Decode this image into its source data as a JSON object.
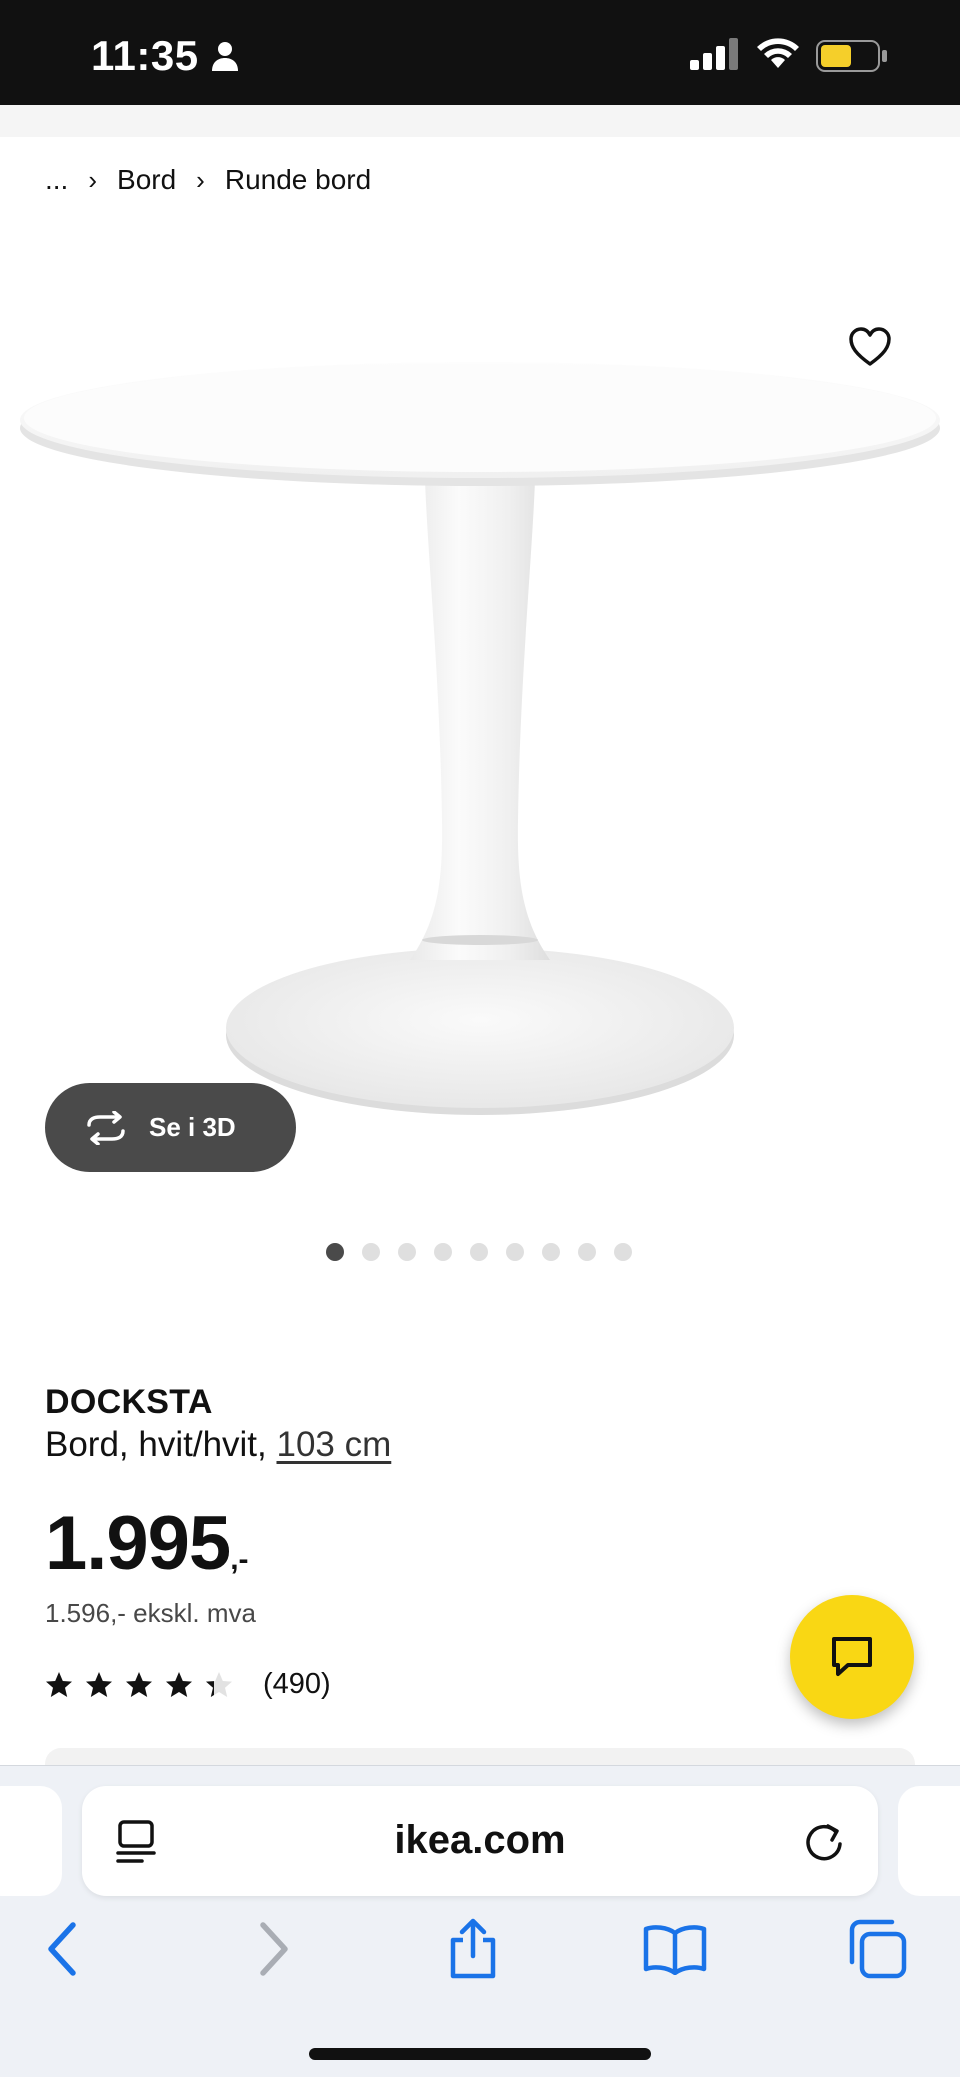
{
  "status_bar": {
    "time": "11:35",
    "icons": [
      "person-icon",
      "signal-icon",
      "wifi-icon",
      "battery-icon"
    ],
    "battery_color": "#f5cf2a"
  },
  "breadcrumb": {
    "items": [
      "...",
      "Bord",
      "Runde bord"
    ]
  },
  "gallery": {
    "see_3d_label": "Se i 3D",
    "favorite_icon": "heart-icon",
    "image_count": 9,
    "active_index": 0
  },
  "product": {
    "name": "DOCKSTA",
    "description": "Bord, hvit/hvit, ",
    "size_link": "103 cm",
    "price": "1.995",
    "price_suffix": ",-",
    "price_excl_vat": "1.596,- ekskl. mva",
    "rating_stars": 4.5,
    "rating_max": 5,
    "review_count": "(490)"
  },
  "chat": {
    "icon": "chat-icon",
    "color": "#f9d714"
  },
  "browser": {
    "url": "ikea.com",
    "icons": [
      "reader-icon",
      "reload-icon",
      "back-icon",
      "forward-icon",
      "share-icon",
      "bookmarks-icon",
      "tabs-icon"
    ],
    "accent": "#1a73e8"
  }
}
